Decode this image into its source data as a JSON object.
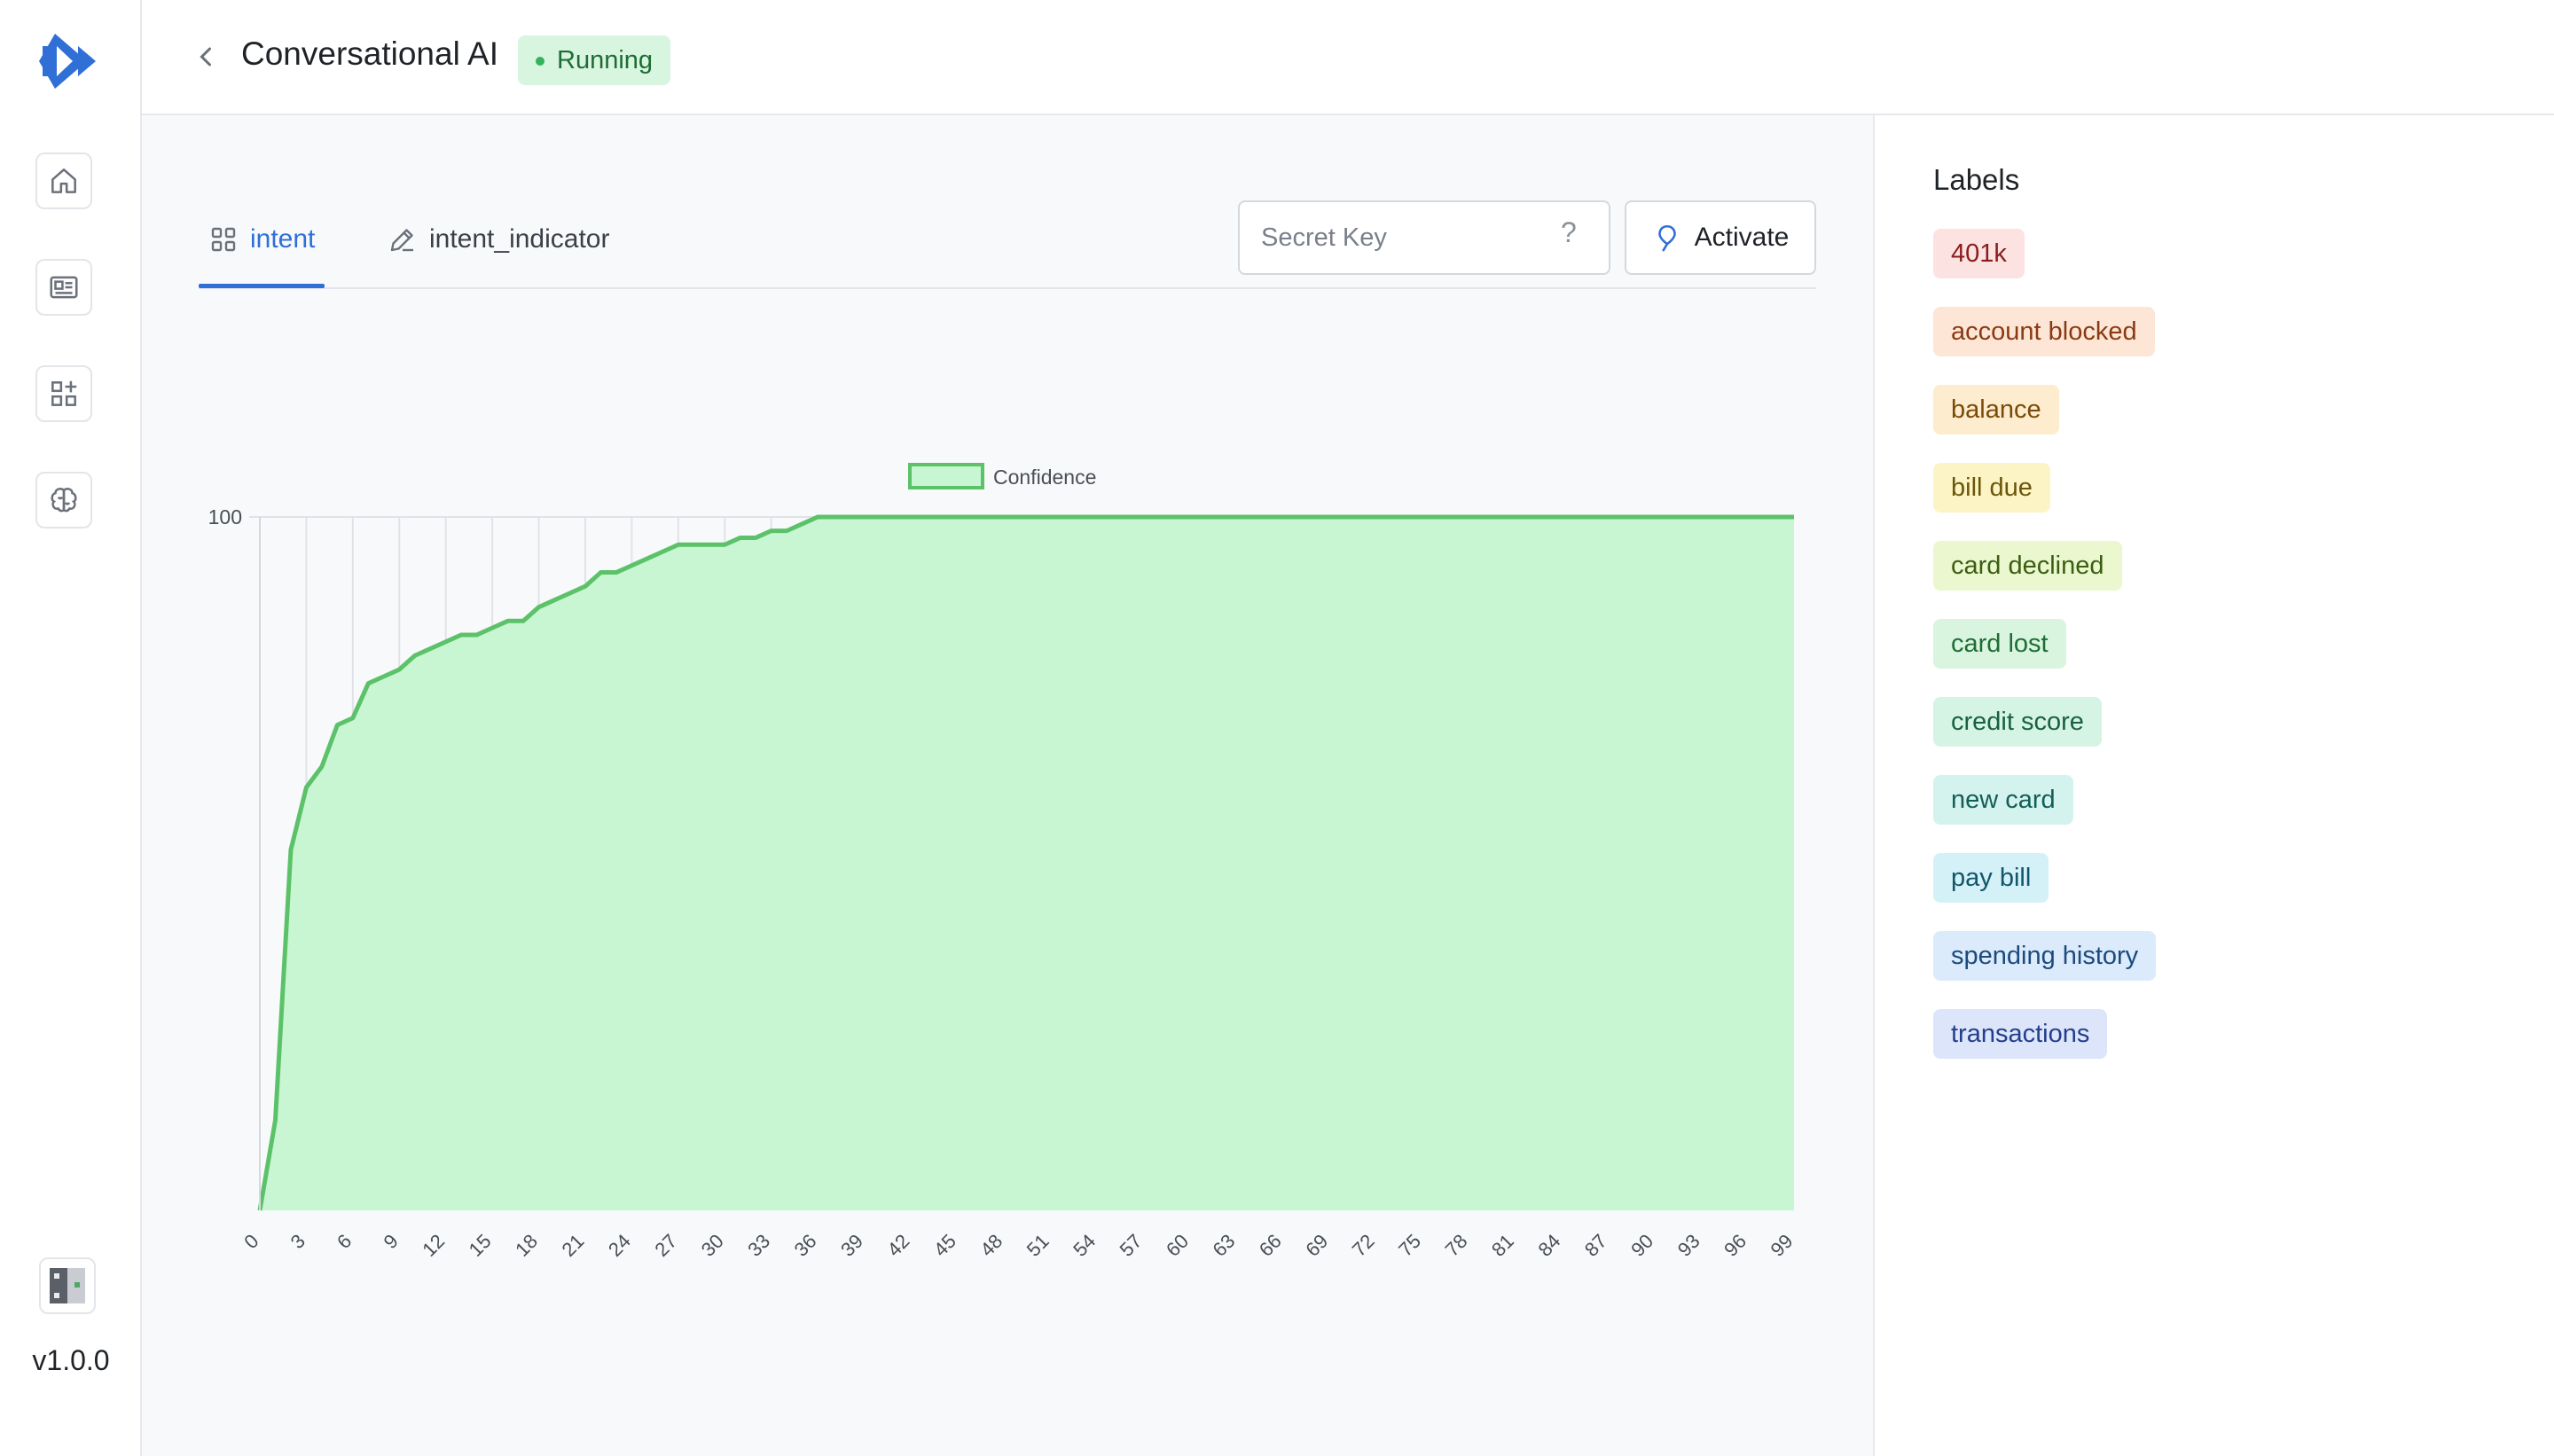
{
  "app": {
    "title": "Conversational AI",
    "status": "Running",
    "version": "v1.0.0"
  },
  "sidebar": {
    "items": [
      {
        "icon": "home-icon"
      },
      {
        "icon": "id-card-icon"
      },
      {
        "icon": "apps-add-icon"
      },
      {
        "icon": "brain-icon"
      }
    ]
  },
  "tabs": [
    {
      "label": "intent",
      "icon": "grid-icon",
      "active": true
    },
    {
      "label": "intent_indicator",
      "icon": "edit-icon",
      "active": false
    }
  ],
  "secret_key": {
    "placeholder": "Secret Key",
    "value": "",
    "help": "?"
  },
  "activate": {
    "label": "Activate"
  },
  "labels_panel": {
    "title": "Labels",
    "items": [
      {
        "label": "401k",
        "bg": "#fde2e2",
        "fg": "#8a1c1c"
      },
      {
        "label": "account blocked",
        "bg": "#fde6d6",
        "fg": "#8a3a12"
      },
      {
        "label": "balance",
        "bg": "#fdeccd",
        "fg": "#7a4a0a"
      },
      {
        "label": "bill due",
        "bg": "#fcf4c4",
        "fg": "#6b560a"
      },
      {
        "label": "card declined",
        "bg": "#eaf7cf",
        "fg": "#3b5e12"
      },
      {
        "label": "card lost",
        "bg": "#d9f5df",
        "fg": "#1f6d35"
      },
      {
        "label": "credit score",
        "bg": "#d6f4e4",
        "fg": "#176044"
      },
      {
        "label": "new card",
        "bg": "#d4f3ee",
        "fg": "#125e56"
      },
      {
        "label": "pay bill",
        "bg": "#d4f1f8",
        "fg": "#11566a"
      },
      {
        "label": "spending history",
        "bg": "#dbebfb",
        "fg": "#1b4a7e"
      },
      {
        "label": "transactions",
        "bg": "#dde5fb",
        "fg": "#233f8c"
      }
    ]
  },
  "chart_data": {
    "type": "area",
    "series": [
      {
        "name": "Confidence",
        "color": "#5cc26a",
        "fill": "#c8f5d2",
        "values": [
          0,
          13,
          52,
          61,
          64,
          70,
          71,
          76,
          77,
          78,
          80,
          81,
          82,
          83,
          83,
          84,
          85,
          85,
          87,
          88,
          89,
          90,
          92,
          92,
          93,
          94,
          95,
          96,
          96,
          96,
          96,
          97,
          97,
          98,
          98,
          99,
          100,
          100,
          100,
          100,
          100,
          100,
          100,
          100,
          100,
          100,
          100,
          100,
          100,
          100,
          100,
          100,
          100,
          100,
          100,
          100,
          100,
          100,
          100,
          100,
          100,
          100,
          100,
          100,
          100,
          100,
          100,
          100,
          100,
          100,
          100,
          100,
          100,
          100,
          100,
          100,
          100,
          100,
          100,
          100,
          100,
          100,
          100,
          100,
          100,
          100,
          100,
          100,
          100,
          100,
          100,
          100,
          100,
          100,
          100,
          100,
          100,
          100,
          100,
          100
        ]
      }
    ],
    "x_min": 0,
    "x_max": 99,
    "x_tick_step": 3,
    "y_ticks": [
      100
    ],
    "ylim": [
      0,
      100
    ],
    "vertical_grid_until": 36,
    "legend": "top-center"
  }
}
